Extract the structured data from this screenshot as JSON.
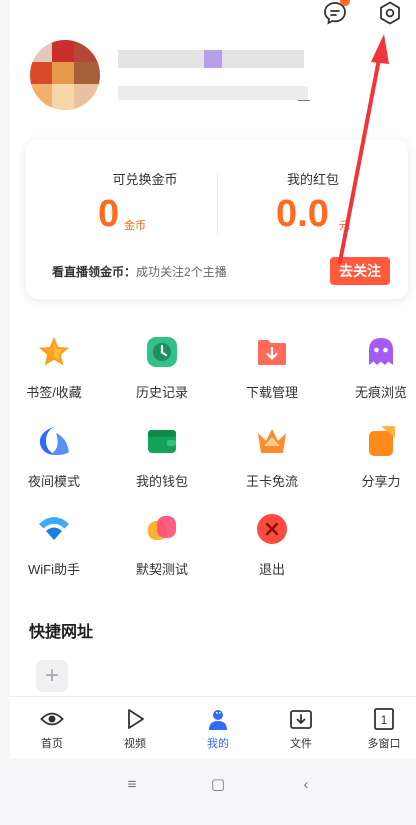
{
  "header": {
    "message_icon": "message-bubble-icon",
    "settings_icon": "gear-icon"
  },
  "profile": {
    "avatar_icon": "avatar"
  },
  "wallet": {
    "coins_label": "可兑换金币",
    "coins_value": "0",
    "coins_unit": "金币",
    "redpacket_label": "我的红包",
    "redpacket_value": "0.0",
    "redpacket_unit": "元",
    "live_label": "看直播领金币：",
    "live_text": "成功关注2个主播",
    "follow_button": "去关注"
  },
  "tools": [
    {
      "label": "书签/收藏",
      "icon": "star-icon"
    },
    {
      "label": "历史记录",
      "icon": "clock-icon"
    },
    {
      "label": "下载管理",
      "icon": "download-folder-icon"
    },
    {
      "label": "无痕浏览",
      "icon": "ghost-icon"
    },
    {
      "label": "夜间模式",
      "icon": "moon-icon"
    },
    {
      "label": "我的钱包",
      "icon": "wallet-icon"
    },
    {
      "label": "王卡免流",
      "icon": "crown-icon"
    },
    {
      "label": "分享力",
      "icon": "share-icon"
    },
    {
      "label": "WiFi助手",
      "icon": "wifi-icon"
    },
    {
      "label": "默契测试",
      "icon": "heart-icon"
    },
    {
      "label": "退出",
      "icon": "exit-icon"
    }
  ],
  "shortcuts": {
    "title": "快捷网址",
    "add_label": "+"
  },
  "bottom_nav": [
    {
      "label": "首页",
      "icon": "eye-icon"
    },
    {
      "label": "视频",
      "icon": "play-icon"
    },
    {
      "label": "我的",
      "icon": "person-icon"
    },
    {
      "label": "文件",
      "icon": "file-download-icon"
    },
    {
      "label": "多窗口",
      "icon": "window-count-icon",
      "count": "1"
    }
  ],
  "system_bar": {
    "menu": "≡",
    "home": "▢",
    "back": "‹"
  },
  "colors": {
    "accent": "#ff6a1f",
    "follow_button": "#ff5a3c",
    "nav_active": "#2f6cf6",
    "annotation_arrow": "#f0343c"
  }
}
